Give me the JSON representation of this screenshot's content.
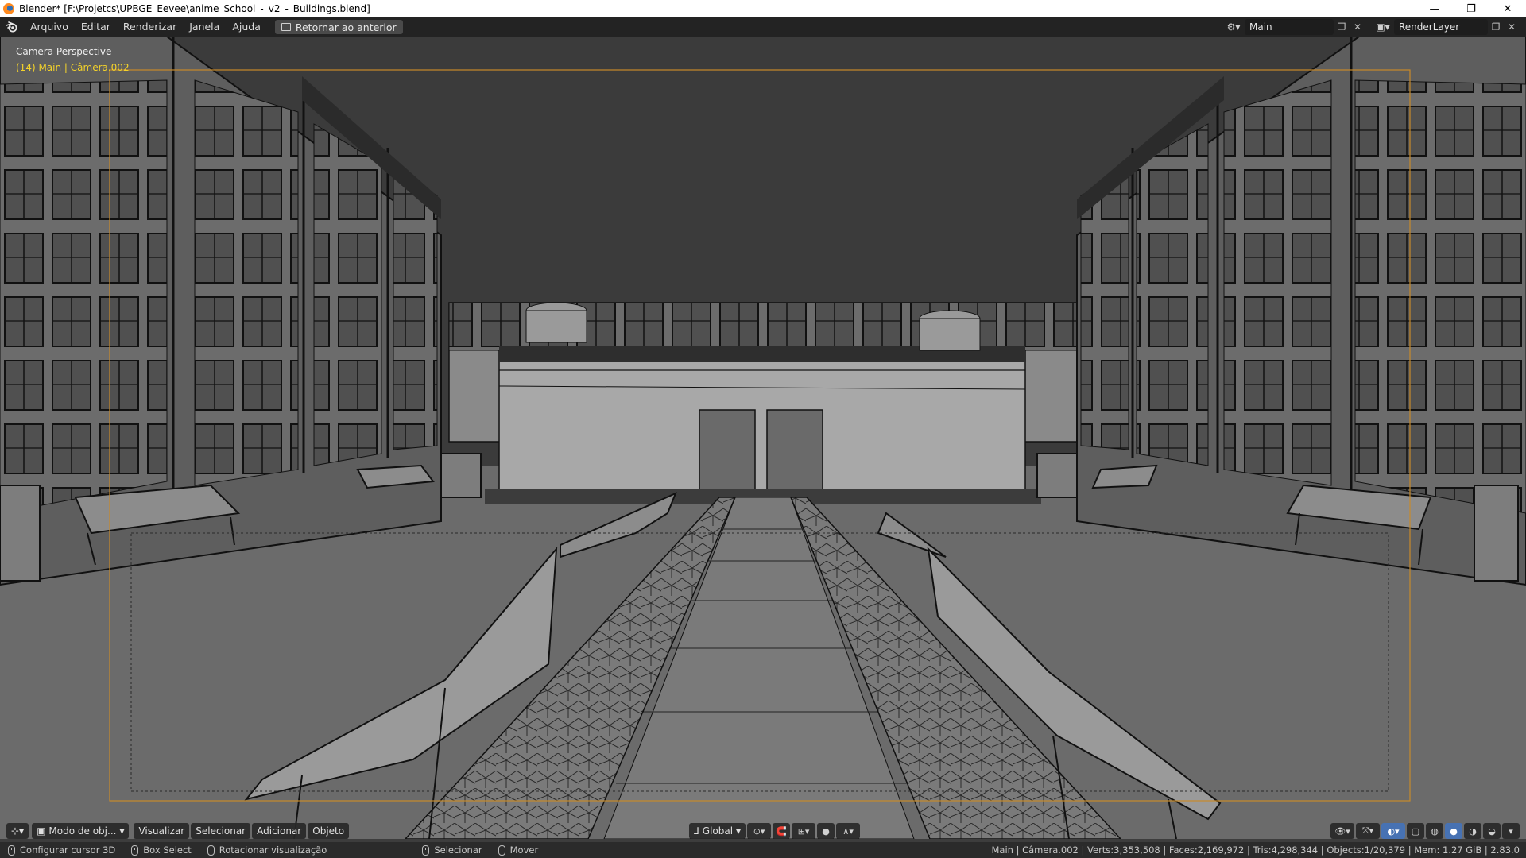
{
  "window": {
    "title": "Blender* [F:\\Projetcs\\UPBGE_Eevee\\anime_School_-_v2_-_Buildings.blend]",
    "minimize": "—",
    "restore": "❐",
    "close": "✕"
  },
  "topbar": {
    "menus": [
      "Arquivo",
      "Editar",
      "Renderizar",
      "Janela",
      "Ajuda"
    ],
    "back_button": "Retornar ao anterior",
    "scene_name": "Main",
    "view_layer": "RenderLayer"
  },
  "viewport": {
    "camera_label": "Camera Perspective",
    "active_object": "(14) Main | Câmera.002"
  },
  "view_header": {
    "mode": "Modo de obj...",
    "menus": [
      "Visualizar",
      "Selecionar",
      "Adicionar",
      "Objeto"
    ],
    "orientation": "Global"
  },
  "statusbar": {
    "hints": [
      "Configurar cursor 3D",
      "Box Select",
      "Rotacionar visualização",
      "Selecionar",
      "Mover"
    ],
    "stats": "Main | Câmera.002 | Verts:3,353,508 | Faces:2,169,972 | Tris:4,298,344 | Objects:1/20,379 | Mem: 1.27 GiB | 2.83.0"
  },
  "colors": {
    "accent": "#4772b3",
    "object_label": "#f3d22b",
    "camera_frame": "#c88a2a"
  }
}
